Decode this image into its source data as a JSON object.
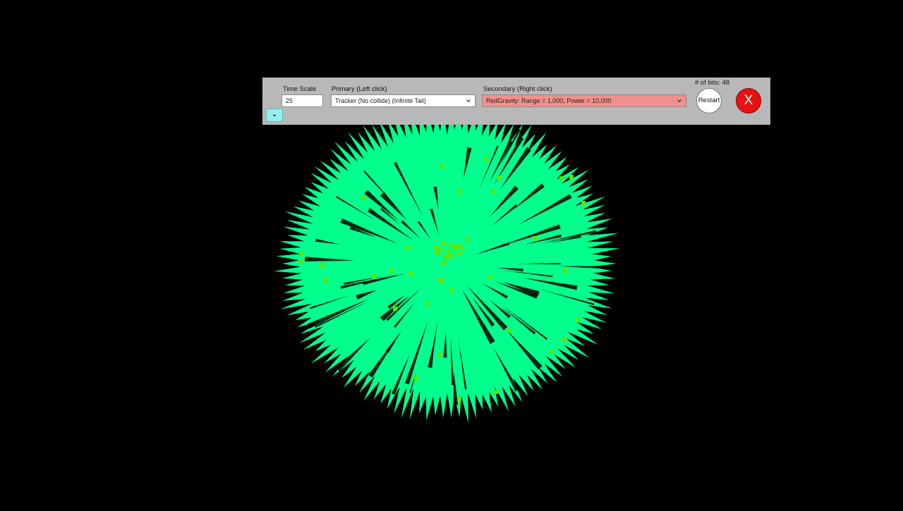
{
  "toolbar": {
    "time_scale_label": "Time Scale",
    "time_scale_value": "25",
    "primary_label": "Primary (Left click)",
    "primary_value": "Tracker (No collide) (Infinite Tail)",
    "secondary_label": "Secondary (Right click)",
    "secondary_value": "RedGravity: Range = 1,000, Power = 10,000",
    "bits_label": "# of bits: 48",
    "restart_label": "Restart",
    "close_label": "X",
    "minus_label": "-"
  },
  "colors": {
    "background": "#000000",
    "swarm": "#00ff8c",
    "bits": "#5fe400",
    "toolbar_bg": "#b8b8b8",
    "secondary_select_bg": "#f1918d",
    "minus_button_bg": "#95eeee",
    "close_button_bg": "#e51212"
  },
  "icons": {
    "dropdown": "chevron-down-icon"
  }
}
